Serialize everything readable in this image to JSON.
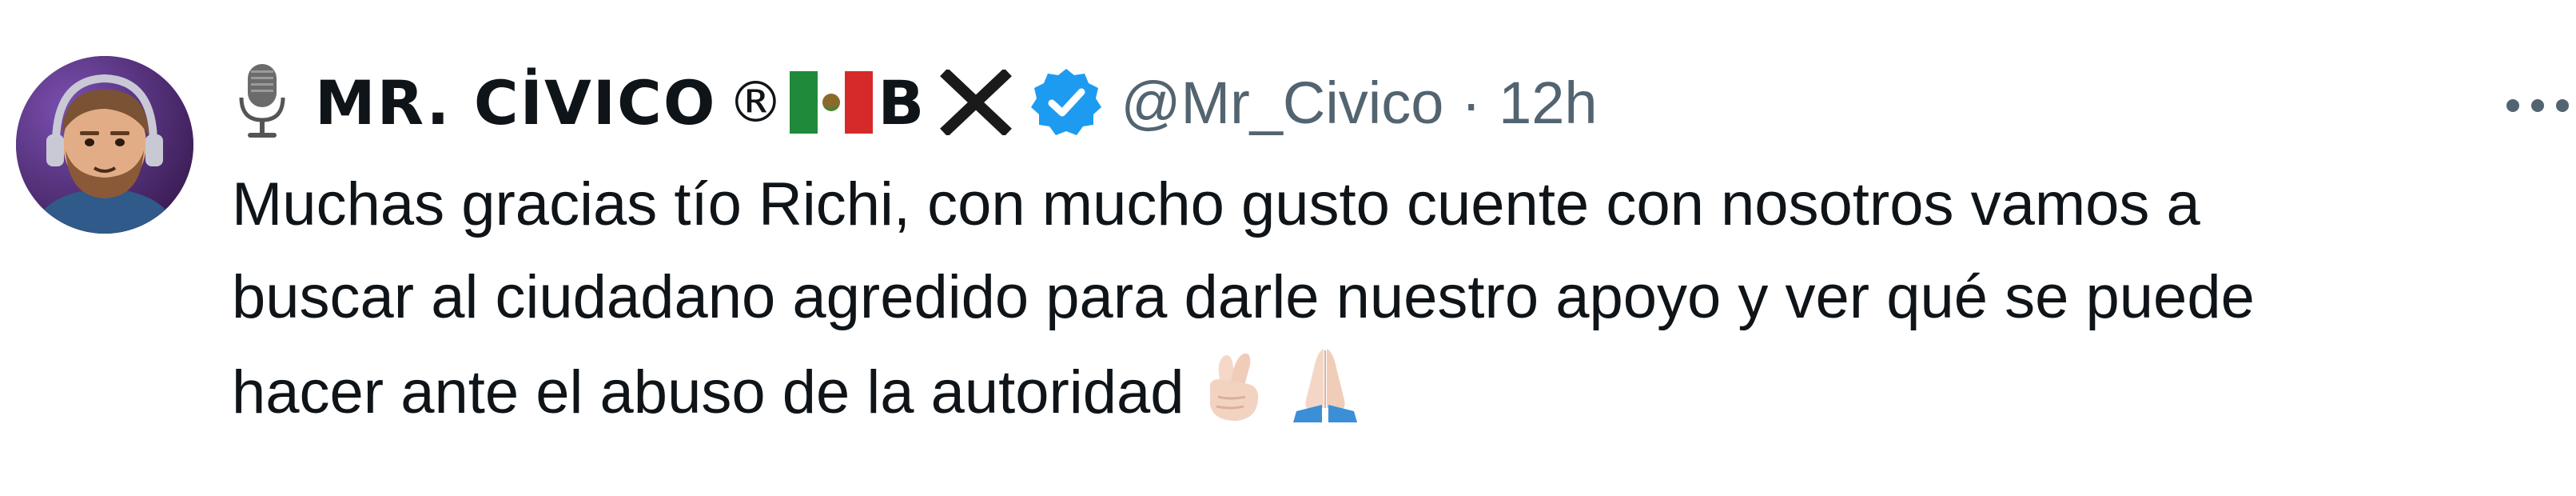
{
  "tweet": {
    "author": {
      "display_name": "MR. CİVICO",
      "registered_mark": "®",
      "name_suffix": "B",
      "handle": "@Mr_Civico",
      "avatar_icon": "avatar-bearded-man",
      "verified": true
    },
    "separator": "·",
    "timestamp": "12h",
    "text_lines": [
      "Muchas gracias tío Richi, con mucho gusto cuente con nosotros vamos a",
      "buscar al ciudadano agredido para darle nuestro apoyo y ver qué se puede",
      "hacer ante el abuso de la autoridad"
    ],
    "emojis": [
      "crossed-fingers-icon",
      "folded-hands-icon"
    ],
    "icons": {
      "name_prefix": "microphone-icon",
      "flag": "mexico-flag-icon",
      "x": "cross-mark-icon",
      "badge": "verified-badge-icon",
      "more": "more-options-icon"
    },
    "colors": {
      "text": "#0f1419",
      "secondary": "#536471",
      "verified_blue": "#1d9bf0"
    }
  }
}
